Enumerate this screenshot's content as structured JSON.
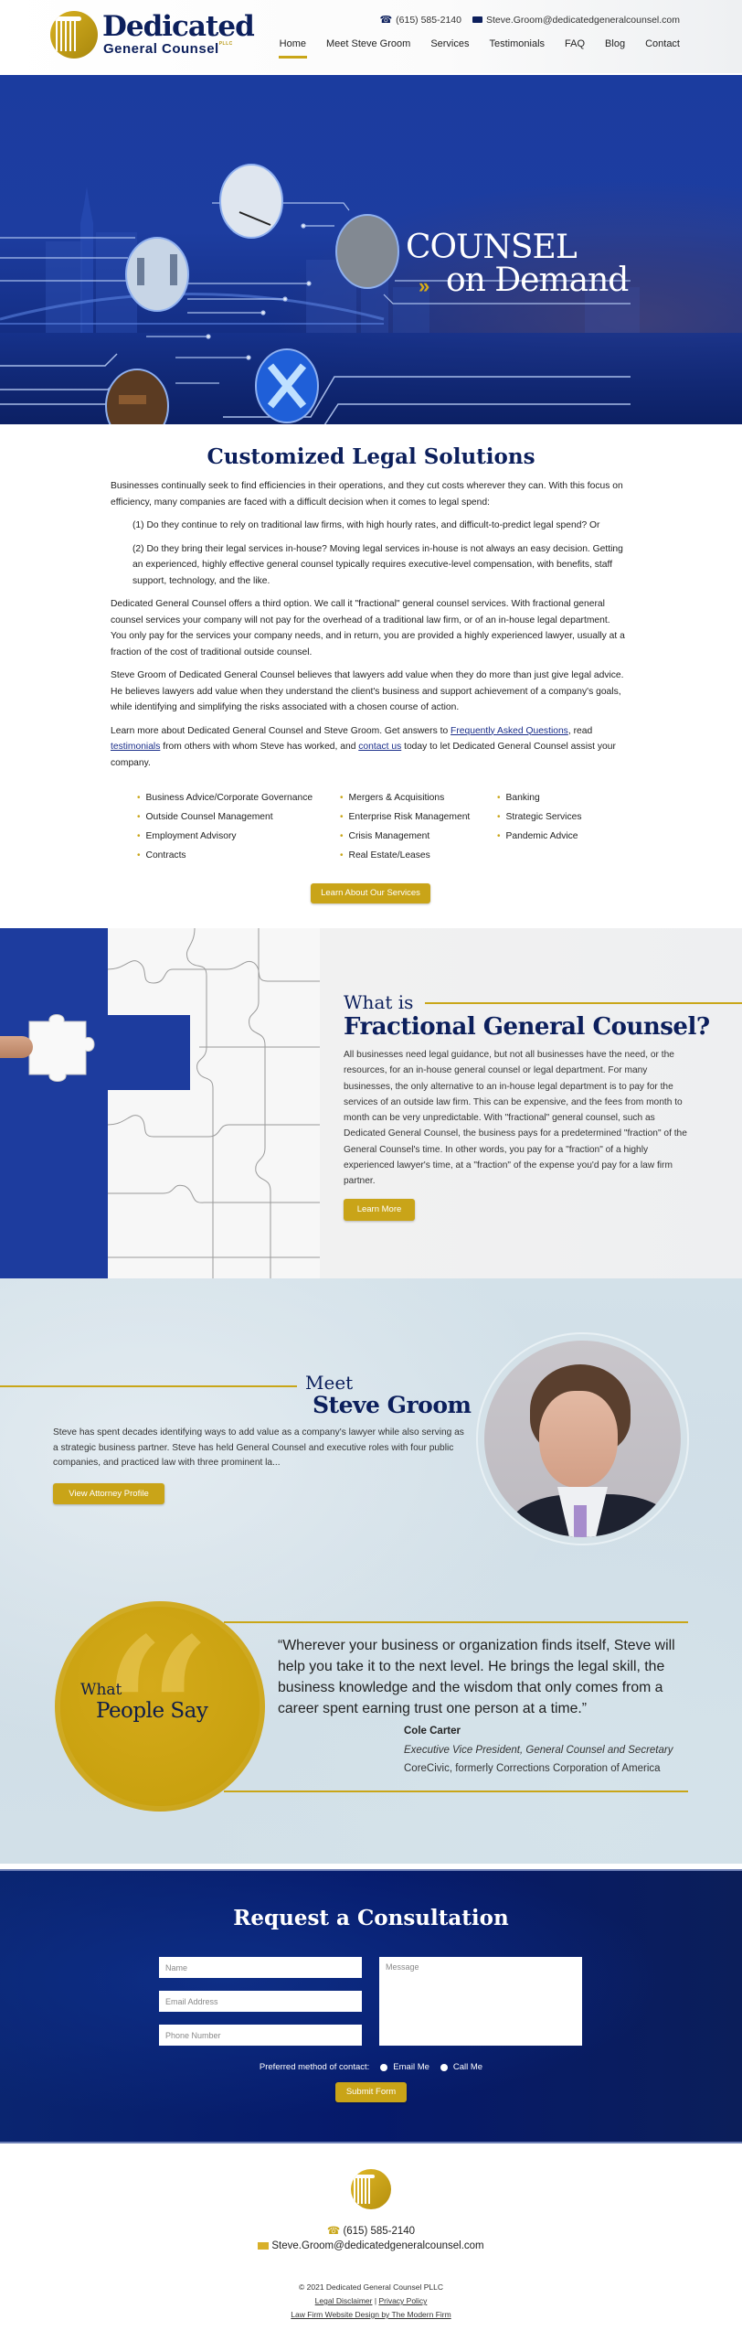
{
  "header": {
    "logo": {
      "title": "Dedicated",
      "subtitle": "General Counsel",
      "suffix": "PLLC"
    },
    "phone": "(615) 585-2140",
    "email": "Steve.Groom@dedicatedgeneralcounsel.com",
    "nav": [
      {
        "label": "Home",
        "active": true
      },
      {
        "label": "Meet Steve Groom"
      },
      {
        "label": "Services"
      },
      {
        "label": "Testimonials"
      },
      {
        "label": "FAQ"
      },
      {
        "label": "Blog"
      },
      {
        "label": "Contact"
      }
    ]
  },
  "hero": {
    "line1": "COUNSEL",
    "line2": "on Demand",
    "arrows": "»"
  },
  "solutions": {
    "title": "Customized Legal Solutions",
    "p1": "Businesses continually seek to find efficiencies in their operations, and they cut costs wherever they can. With this focus on efficiency, many companies are faced with a difficult decision when it comes to legal spend:",
    "q1": "(1) Do they continue to rely on traditional law firms, with high hourly rates, and difficult-to-predict legal spend? Or",
    "q2": "(2) Do they bring their legal services in-house? Moving legal services in-house is not always an easy decision. Getting an experienced, highly effective general counsel typically requires executive-level compensation, with benefits, staff support, technology, and the like.",
    "p2": "Dedicated General Counsel offers a third option. We call it \"fractional\" general counsel services. With fractional general counsel services your company will not pay for the overhead of a traditional law firm, or of an in-house legal department. You only pay for the services your company needs, and in return, you are provided a highly experienced lawyer, usually at a fraction of the cost of traditional outside counsel.",
    "p3": "Steve Groom of Dedicated General Counsel believes that lawyers add value when they do more than just give legal advice. He believes lawyers add value when they understand the client's business and support achievement of a company's goals, while identifying and simplifying the risks associated with a chosen course of action.",
    "p4_a": "Learn more about Dedicated General Counsel and Steve Groom. Get answers to ",
    "p4_link1": "Frequently Asked Questions",
    "p4_b": ", read ",
    "p4_link2": "testimonials",
    "p4_c": " from others with whom Steve has worked, and ",
    "p4_link3": "contact us",
    "p4_d": " today to let Dedicated General Counsel assist your company.",
    "services": [
      "Business Advice/Corporate Governance",
      "Mergers & Acquisitions",
      "Banking",
      "Outside Counsel Management",
      "Enterprise Risk Management",
      "Strategic Services",
      "Employment Advisory",
      "Crisis Management",
      "Pandemic Advice",
      "Contracts",
      "Real Estate/Leases",
      ""
    ],
    "button": "Learn About Our Services"
  },
  "fractional": {
    "what_is": "What is",
    "title": "Fractional General Counsel?",
    "body": "All businesses need legal guidance, but not all businesses have the need, or the resources, for an in-house general counsel or legal department. For many businesses, the only alternative to an in-house legal department is to pay for the services of an outside law firm. This can be expensive, and the fees from month to month can be very unpredictable. With \"fractional\" general counsel, such as Dedicated General Counsel, the business pays for a predetermined \"fraction\" of the General Counsel's time. In other words, you pay for a \"fraction\" of a highly experienced lawyer's time, at a \"fraction\" of the expense you'd pay for a law firm partner.",
    "button": "Learn More"
  },
  "meet": {
    "word": "Meet",
    "name": "Steve Groom",
    "body": "Steve has spent decades identifying ways to add value as a company's lawyer while also serving as a strategic business partner. Steve has held General Counsel and executive roles with four public companies, and practiced law with three prominent la...",
    "button": "View Attorney Profile"
  },
  "testimonial": {
    "heading_small": "What",
    "heading_large": "People Say",
    "quote": "“Wherever your business or organization finds itself, Steve will help you take it to the next level. He brings the legal skill, the business knowledge and the wisdom that only comes from a career spent earning trust one person at a time.”",
    "author": "Cole Carter",
    "role": "Executive Vice President, General Counsel and Secretary",
    "org": "CoreCivic, formerly Corrections Corporation of America"
  },
  "consultation": {
    "title": "Request a Consultation",
    "name_placeholder": "Name",
    "email_placeholder": "Email Address",
    "phone_placeholder": "Phone Number",
    "message_placeholder": "Message",
    "preferred_label": "Preferred method of contact:",
    "option_email": "Email Me",
    "option_call": "Call Me",
    "submit": "Submit Form"
  },
  "footer": {
    "phone": "(615) 585-2140",
    "email": "Steve.Groom@dedicatedgeneralcounsel.com",
    "copyright": "© 2021 Dedicated General Counsel PLLC",
    "legal_disclaimer": "Legal Disclaimer",
    "separator": " | ",
    "privacy_policy": "Privacy Policy",
    "credit": "Law Firm Website Design by The Modern Firm"
  },
  "colors": {
    "navy": "#0c1f5c",
    "gold": "#c9a418",
    "hero_blue": "#1d3c9e",
    "consult_blue": "#05196a"
  }
}
